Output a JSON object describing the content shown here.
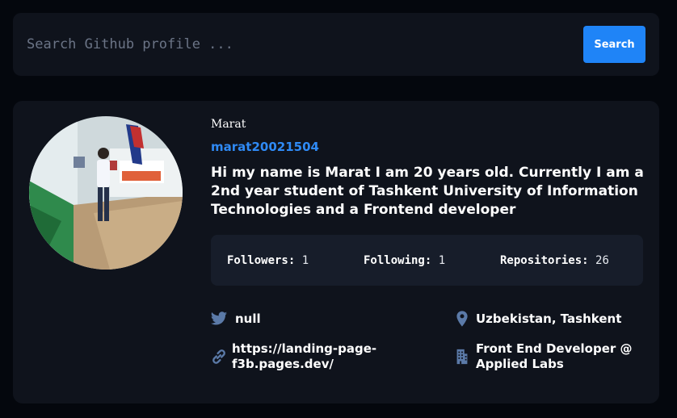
{
  "search": {
    "placeholder": "Search Github profile ...",
    "button_label": "Search"
  },
  "profile": {
    "display_name": "Marat",
    "username": "marat20021504",
    "bio": "Hi my name is Marat I am 20 years old. Currently I am a 2nd year student of Tashkent University of Information Technologies and a Frontend developer",
    "stats": {
      "followers_label": "Followers:",
      "followers": "1",
      "following_label": "Following:",
      "following": "1",
      "repositories_label": "Repositories:",
      "repositories": "26"
    },
    "twitter": "null",
    "location": "Uzbekistan, Tashkent",
    "website_line1": "https://landing-page-",
    "website_line2": "f3b.pages.dev/",
    "company_line1": "Front End Developer @",
    "company_line2": "Applied Labs"
  },
  "colors": {
    "accent": "#1f84f7",
    "link": "#2f8af5",
    "icon": "#5b7aa8",
    "card": "#0f131c",
    "background": "#04070d",
    "stats_panel": "#171d2a"
  },
  "icons": {
    "twitter": "twitter-icon",
    "location": "location-pin-icon",
    "link": "link-icon",
    "company": "building-icon"
  }
}
